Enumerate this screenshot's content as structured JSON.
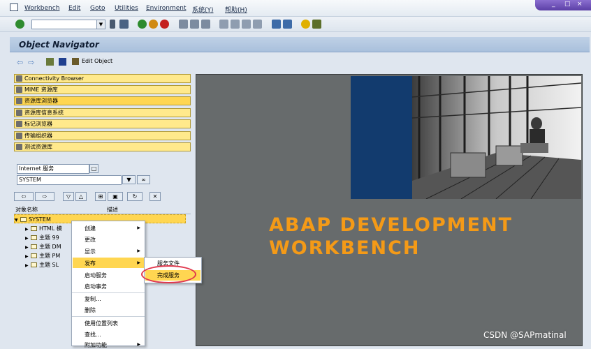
{
  "menu": {
    "items": [
      {
        "label": "Workbench"
      },
      {
        "label": "Edit"
      },
      {
        "label": "Goto"
      },
      {
        "label": "Utilities"
      },
      {
        "label": "Environment"
      },
      {
        "label": "系统(Y)"
      },
      {
        "label": "帮助(H)"
      }
    ]
  },
  "window_controls": [
    "_",
    "□",
    "×"
  ],
  "toolbar": {
    "command_field_value": ""
  },
  "title": "Object Navigator",
  "app_toolbar": {
    "edit_object_label": "Edit Object"
  },
  "nav_buttons": [
    {
      "label": "Connectivity Browser"
    },
    {
      "label": "MIME 资源库"
    },
    {
      "label": "资源库浏览器"
    },
    {
      "label": "资源库信息系统"
    },
    {
      "label": "标记浏览器"
    },
    {
      "label": "传输组织器"
    },
    {
      "label": "测试资源库"
    }
  ],
  "object_selector": {
    "type_value": "Internet 服务",
    "name_value": "SYSTEM"
  },
  "tree": {
    "col_name": "对象名称",
    "col_desc": "描述",
    "root": "SYSTEM",
    "children": [
      "HTML 模",
      "主题 99",
      "主题 DM",
      "主题 PM",
      "主题 SL"
    ]
  },
  "context_menu": {
    "items": [
      "创建",
      "更改",
      "显示",
      "发布",
      "启动服务",
      "启动事务",
      "复制...",
      "删除",
      "使用位置列表",
      "查找...",
      "附加功能"
    ]
  },
  "submenu": {
    "items": [
      "服务文件",
      "完成服务"
    ]
  },
  "splash": {
    "line1": "ABAP DEVELOPMENT",
    "line2": "WORKBENCH"
  },
  "watermark": "CSDN @SAPmatinal",
  "colors": {
    "accent": "#ffd651",
    "brand_orange": "#f49a17",
    "highlight_ring": "#e0374d"
  }
}
